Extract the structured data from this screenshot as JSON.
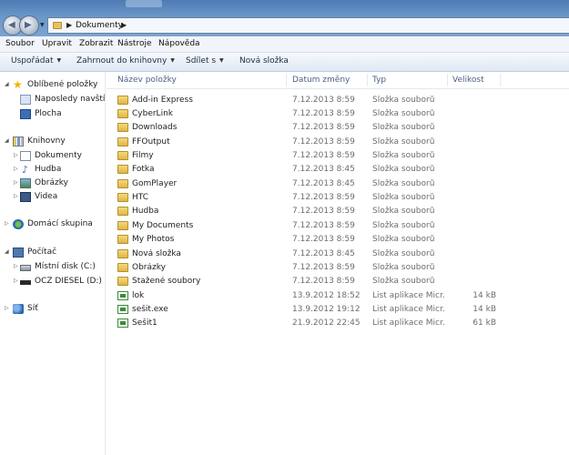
{
  "address": {
    "crumb": "Dokumenty"
  },
  "menu": [
    "Soubor",
    "Upravit",
    "Zobrazit",
    "Nástroje",
    "Nápověda"
  ],
  "toolbar": {
    "organize": "Uspořádat",
    "include": "Zahrnout do knihovny",
    "share": "Sdílet s",
    "new_folder": "Nová složka"
  },
  "nav": {
    "favorites": "Oblíbené položky",
    "recent": "Naposledy navštívené",
    "desktop": "Plocha",
    "libraries": "Knihovny",
    "documents": "Dokumenty",
    "music": "Hudba",
    "pictures": "Obrázky",
    "videos": "Videa",
    "homegroup": "Domácí skupina",
    "computer": "Počítač",
    "local_disk": "Místní disk (C:)",
    "ocz": "OCZ DIESEL (D:)",
    "network": "Síť"
  },
  "columns": {
    "name": "Název položky",
    "date": "Datum změny",
    "type": "Typ",
    "size": "Velikost"
  },
  "files": [
    {
      "name": "Add-in Express",
      "date": "7.12.2013 8:59",
      "type": "Složka souborů",
      "size": "",
      "icon": "folder-icon"
    },
    {
      "name": "CyberLink",
      "date": "7.12.2013 8:59",
      "type": "Složka souborů",
      "size": "",
      "icon": "folder-icon"
    },
    {
      "name": "Downloads",
      "date": "7.12.2013 8:59",
      "type": "Složka souborů",
      "size": "",
      "icon": "folder-icon"
    },
    {
      "name": "FFOutput",
      "date": "7.12.2013 8:59",
      "type": "Složka souborů",
      "size": "",
      "icon": "folder-icon"
    },
    {
      "name": "Filmy",
      "date": "7.12.2013 8:59",
      "type": "Složka souborů",
      "size": "",
      "icon": "folder-icon"
    },
    {
      "name": "Fotka",
      "date": "7.12.2013 8:45",
      "type": "Složka souborů",
      "size": "",
      "icon": "folder-icon"
    },
    {
      "name": "GomPlayer",
      "date": "7.12.2013 8:45",
      "type": "Složka souborů",
      "size": "",
      "icon": "folder-icon"
    },
    {
      "name": "HTC",
      "date": "7.12.2013 8:59",
      "type": "Složka souborů",
      "size": "",
      "icon": "folder-icon"
    },
    {
      "name": "Hudba",
      "date": "7.12.2013 8:59",
      "type": "Složka souborů",
      "size": "",
      "icon": "folder-icon"
    },
    {
      "name": "My Documents",
      "date": "7.12.2013 8:59",
      "type": "Složka souborů",
      "size": "",
      "icon": "folder-icon"
    },
    {
      "name": "My Photos",
      "date": "7.12.2013 8:59",
      "type": "Složka souborů",
      "size": "",
      "icon": "folder-icon"
    },
    {
      "name": "Nová složka",
      "date": "7.12.2013 8:45",
      "type": "Složka souborů",
      "size": "",
      "icon": "folder-icon"
    },
    {
      "name": "Obrázky",
      "date": "7.12.2013 8:59",
      "type": "Složka souborů",
      "size": "",
      "icon": "folder-icon"
    },
    {
      "name": "Stažené soubory",
      "date": "7.12.2013 8:59",
      "type": "Složka souborů",
      "size": "",
      "icon": "folder-icon"
    },
    {
      "name": "lok",
      "date": "13.9.2012 18:52",
      "type": "List aplikace Micr...",
      "size": "14 kB",
      "icon": "excel-file-icon"
    },
    {
      "name": "sešit.exe",
      "date": "13.9.2012 19:12",
      "type": "List aplikace Micr...",
      "size": "14 kB",
      "icon": "excel-file-icon"
    },
    {
      "name": "Sešit1",
      "date": "21.9.2012 22:45",
      "type": "List aplikace Micr...",
      "size": "61 kB",
      "icon": "excel-file-icon"
    }
  ]
}
